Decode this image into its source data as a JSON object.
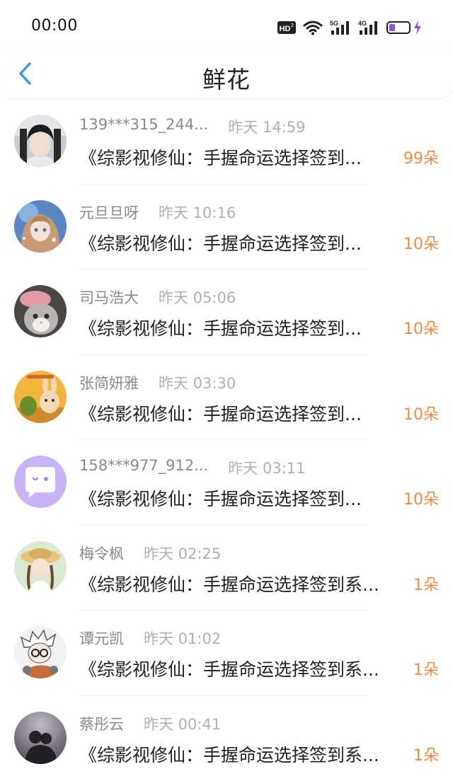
{
  "status_bar": {
    "time": "00:00",
    "hd_label": "HD",
    "hd_sub": "2",
    "signal_5g_label": "5G",
    "signal_4g_label": "4G"
  },
  "header": {
    "title": "鲜花"
  },
  "colors": {
    "accent_blue": "#3b9cf5",
    "amount_orange": "#ef8a43",
    "battery_purple": "#8a4df0"
  },
  "items": [
    {
      "username": "139***315_244...",
      "time": "昨天 14:59",
      "desc": "《综影视修仙：手握命运选择签到...",
      "amount": "99朵",
      "avatar": "man-ancient-costume"
    },
    {
      "username": "元旦旦呀",
      "time": "昨天 10:16",
      "desc": "《综影视修仙：手握命运选择签到...",
      "amount": "10朵",
      "avatar": "anime-girl"
    },
    {
      "username": "司马浩大",
      "time": "昨天 05:06",
      "desc": "《综影视修仙：手握命运选择签到...",
      "amount": "10朵",
      "avatar": "cat"
    },
    {
      "username": "张简妍雅",
      "time": "昨天 03:30",
      "desc": "《综影视修仙：手握命运选择签到...",
      "amount": "10朵",
      "avatar": "cartoon-rabbit"
    },
    {
      "username": "158***977_912...",
      "time": "昨天 03:11",
      "desc": "《综影视修仙：手握命运选择签到...",
      "amount": "10朵",
      "avatar": "chat-bubble-default"
    },
    {
      "username": "梅令枫",
      "time": "昨天 02:25",
      "desc": "《综影视修仙：手握命运选择签到系...",
      "amount": "1朵",
      "avatar": "girl-straw-hat"
    },
    {
      "username": "谭元凯",
      "time": "昨天 01:02",
      "desc": "《综影视修仙：手握命运选择签到系...",
      "amount": "1朵",
      "avatar": "cartoon-boy-glasses"
    },
    {
      "username": "蔡彤云",
      "time": "昨天 00:41",
      "desc": "《综影视修仙：手握命运选择签到系...",
      "amount": "1朵",
      "avatar": "couple-silhouette"
    }
  ]
}
